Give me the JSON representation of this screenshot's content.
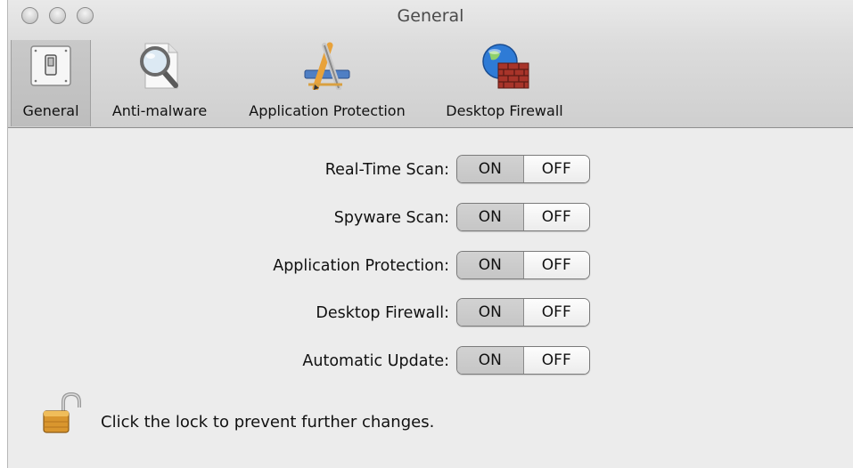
{
  "window": {
    "title": "General",
    "controls": [
      "close-button",
      "minimize-button",
      "zoom-button"
    ]
  },
  "toolbar": {
    "items": [
      {
        "label": "General",
        "icon": "switch-icon",
        "selected": true
      },
      {
        "label": "Anti-malware",
        "icon": "magnifier-icon",
        "selected": false
      },
      {
        "label": "Application Protection",
        "icon": "app-tools-icon",
        "selected": false
      },
      {
        "label": "Desktop Firewall",
        "icon": "globe-firewall-icon",
        "selected": false
      }
    ]
  },
  "settings": [
    {
      "label": "Real-Time Scan:",
      "on_label": "ON",
      "off_label": "OFF",
      "value": "ON"
    },
    {
      "label": "Spyware Scan:",
      "on_label": "ON",
      "off_label": "OFF",
      "value": "ON"
    },
    {
      "label": "Application Protection:",
      "on_label": "ON",
      "off_label": "OFF",
      "value": "ON"
    },
    {
      "label": "Desktop Firewall:",
      "on_label": "ON",
      "off_label": "OFF",
      "value": "ON"
    },
    {
      "label": "Automatic Update:",
      "on_label": "ON",
      "off_label": "OFF",
      "value": "ON"
    }
  ],
  "lock": {
    "icon": "unlocked-padlock-icon",
    "text": "Click the lock to prevent further changes.",
    "state": "unlocked"
  }
}
